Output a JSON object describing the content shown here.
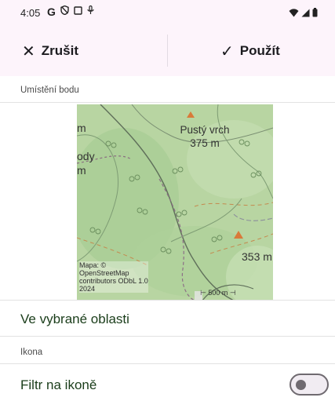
{
  "status_bar": {
    "time": "4:05",
    "icons_left": [
      "google-icon",
      "shield-icon",
      "screen-icon",
      "mic-icon"
    ],
    "icons_right": [
      "wifi-icon",
      "signal-icon",
      "battery-icon"
    ]
  },
  "action_bar": {
    "cancel_label": "Zrušit",
    "apply_label": "Použít"
  },
  "section_location": {
    "label": "Umístění bodu"
  },
  "map": {
    "peak_name": "Pustý vrch",
    "peak_elevation": "375 m",
    "second_elevation": "353 m",
    "edge_text_1": "m",
    "edge_text_2": "ody",
    "edge_text_3": "m",
    "attribution_1": "Mapa: ©",
    "attribution_2": "OpenStreetMap",
    "attribution_3": "contributors ODbL 1.0",
    "attribution_4": "2024",
    "scale_label": "500 m"
  },
  "area_row": {
    "label": "Ve vybrané oblasti"
  },
  "section_icon": {
    "label": "Ikona"
  },
  "filter_row": {
    "label": "Filtr na ikoně",
    "toggle_on": false
  },
  "colors": {
    "topbar_bg": "#fdf4fb",
    "map_green": "#b9d6a4",
    "row_text": "#1a3d1a",
    "peak_marker": "#d97a3a"
  }
}
